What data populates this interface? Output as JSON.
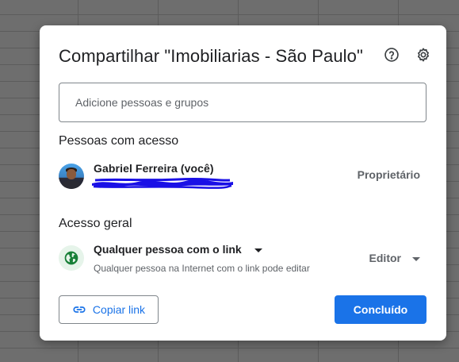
{
  "dialog": {
    "title": "Compartilhar \"Imobiliarias - São Paulo\"",
    "help_icon": "help-circle-icon",
    "settings_icon": "gear-icon"
  },
  "add_people": {
    "placeholder": "Adicione pessoas e grupos"
  },
  "people_section": {
    "heading": "Pessoas com acesso",
    "people": [
      {
        "name": "Gabriel Ferreira (você)",
        "email_redacted": true,
        "role": "Proprietário"
      }
    ]
  },
  "general_access": {
    "heading": "Acesso geral",
    "scope_label": "Qualquer pessoa com o link",
    "description": "Qualquer pessoa na Internet com o link pode editar",
    "role": "Editor",
    "icon": "globe-icon"
  },
  "actions": {
    "copy_link": "Copiar link",
    "done": "Concluído"
  },
  "colors": {
    "primary": "#1a73e8",
    "redaction": "#1a10e6",
    "globe": "#188038"
  }
}
